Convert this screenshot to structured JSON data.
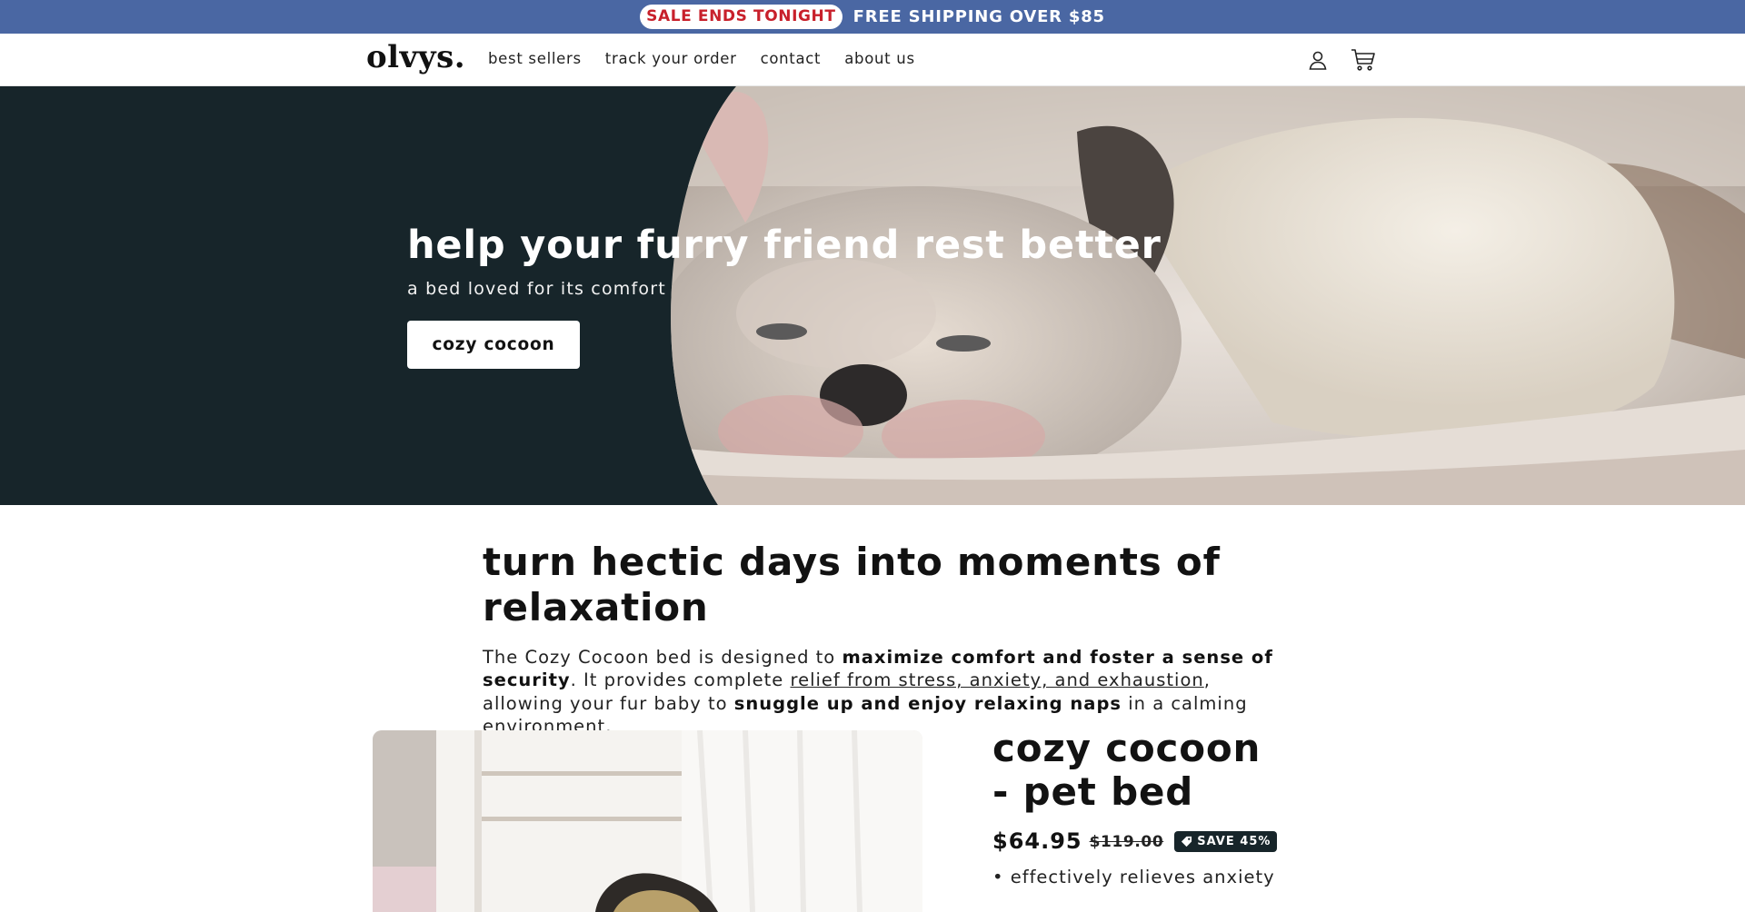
{
  "announcement": {
    "pill_text": "SALE ENDS TONIGHT",
    "shipping_text": "FREE SHIPPING OVER $85"
  },
  "header": {
    "logo": "olvys.",
    "nav": [
      "best sellers",
      "track your order",
      "contact",
      "about us"
    ],
    "icons": [
      "account-icon",
      "cart-icon"
    ]
  },
  "hero": {
    "title": "help your furry friend rest better",
    "subtitle": "a bed loved for its comfort",
    "button_label": "cozy cocoon"
  },
  "relax": {
    "heading": "turn hectic days into moments of relaxation",
    "p1": "The Cozy Cocoon bed is designed to ",
    "p1_bold": "maximize comfort and foster a sense of security",
    "p2": ". It provides complete ",
    "p2_link": "relief from stress, anxiety, and exhaustion",
    "p3": ", allowing your fur baby to ",
    "p3_bold": "snuggle up and enjoy relaxing naps",
    "p4": " in a calming environment."
  },
  "product": {
    "title": "cozy cocoon - pet bed",
    "price": "$64.95",
    "compare_price": "$119.00",
    "save_badge": "SAVE 45%",
    "bullet": "• effectively relieves anxiety"
  },
  "colors": {
    "announcement_bg": "#4a67a3",
    "sale_pill_text": "#c8202b",
    "hero_bg": "#17252a",
    "badge_bg": "#17252a"
  }
}
